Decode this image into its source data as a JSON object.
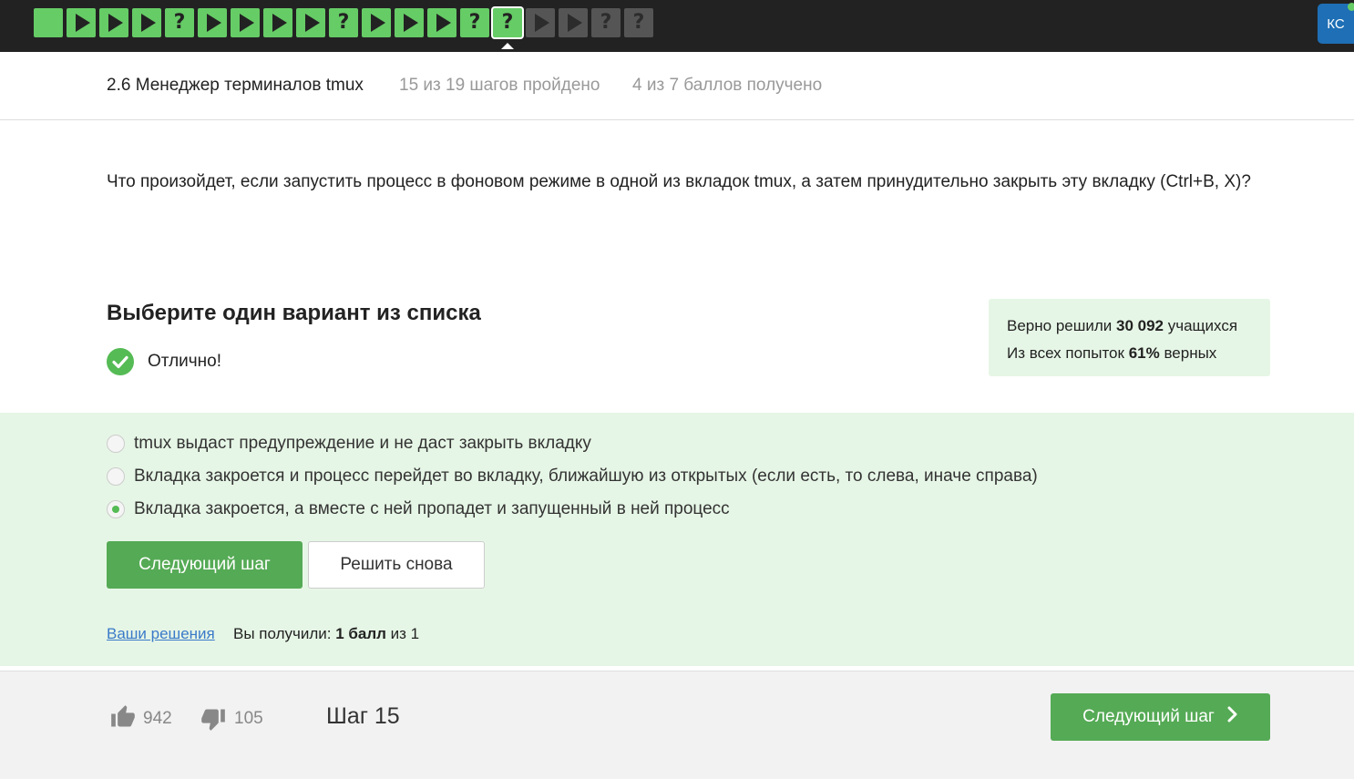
{
  "topbar": {
    "steps": [
      {
        "kind": "blank",
        "state": "done"
      },
      {
        "kind": "play",
        "state": "done"
      },
      {
        "kind": "play",
        "state": "done"
      },
      {
        "kind": "play",
        "state": "done"
      },
      {
        "kind": "quiz",
        "label": "?",
        "state": "done"
      },
      {
        "kind": "play",
        "state": "done"
      },
      {
        "kind": "play",
        "state": "done"
      },
      {
        "kind": "play",
        "state": "done"
      },
      {
        "kind": "play",
        "state": "done"
      },
      {
        "kind": "quiz",
        "label": "?",
        "state": "done"
      },
      {
        "kind": "play",
        "state": "done"
      },
      {
        "kind": "play",
        "state": "done"
      },
      {
        "kind": "play",
        "state": "done"
      },
      {
        "kind": "quiz",
        "label": "?",
        "state": "done"
      },
      {
        "kind": "quiz",
        "label": "?",
        "state": "current"
      },
      {
        "kind": "play",
        "state": "todo"
      },
      {
        "kind": "play",
        "state": "todo"
      },
      {
        "kind": "quiz",
        "label": "?",
        "state": "todo"
      },
      {
        "kind": "quiz",
        "label": "?",
        "state": "todo"
      }
    ],
    "avatar_initials": "КС",
    "colors": {
      "done": "#66cc66",
      "todo": "#555555",
      "bar": "#222222",
      "avatar": "#1e6fb5"
    }
  },
  "lesson": {
    "title": "2.6 Менеджер терминалов tmux",
    "progress": "15 из 19 шагов пройдено",
    "score": "4 из 7 баллов  получено"
  },
  "question": {
    "text": "Что произойдет, если запустить процесс в фоновом режиме в одной из вкладок tmux, а затем принудительно закрыть эту вкладку (Ctrl+B, X)?"
  },
  "quiz": {
    "title": "Выберите один вариант из списка",
    "feedback": "Отлично!",
    "stats": {
      "line1_prefix": "Верно решили ",
      "line1_value": "30 092",
      "line1_suffix": " учащихся",
      "line2_prefix": "Из всех попыток ",
      "line2_value": "61%",
      "line2_suffix": " верных"
    },
    "options": [
      {
        "text": "tmux выдаст предупреждение и не даст закрыть вкладку",
        "selected": false
      },
      {
        "text": "Вкладка закроется и процесс перейдет во вкладку, ближайшую из открытых (если есть, то слева, иначе справа)",
        "selected": false
      },
      {
        "text": "Вкладка закроется, а вместе с ней пропадет и запущенный в ней процесс",
        "selected": true
      }
    ],
    "next_button": "Следующий шаг",
    "retry_button": "Решить снова",
    "solutions_link": "Ваши решения",
    "received_prefix": "Вы получили: ",
    "received_value": "1 балл",
    "received_suffix": " из 1",
    "colors": {
      "correct_bg": "#e6f6e6",
      "accent": "#55aa55",
      "link": "#3a7ac9"
    }
  },
  "footer": {
    "likes": "942",
    "dislikes": "105",
    "step_label": "Шаг 15",
    "next_button": "Следующий шаг"
  }
}
